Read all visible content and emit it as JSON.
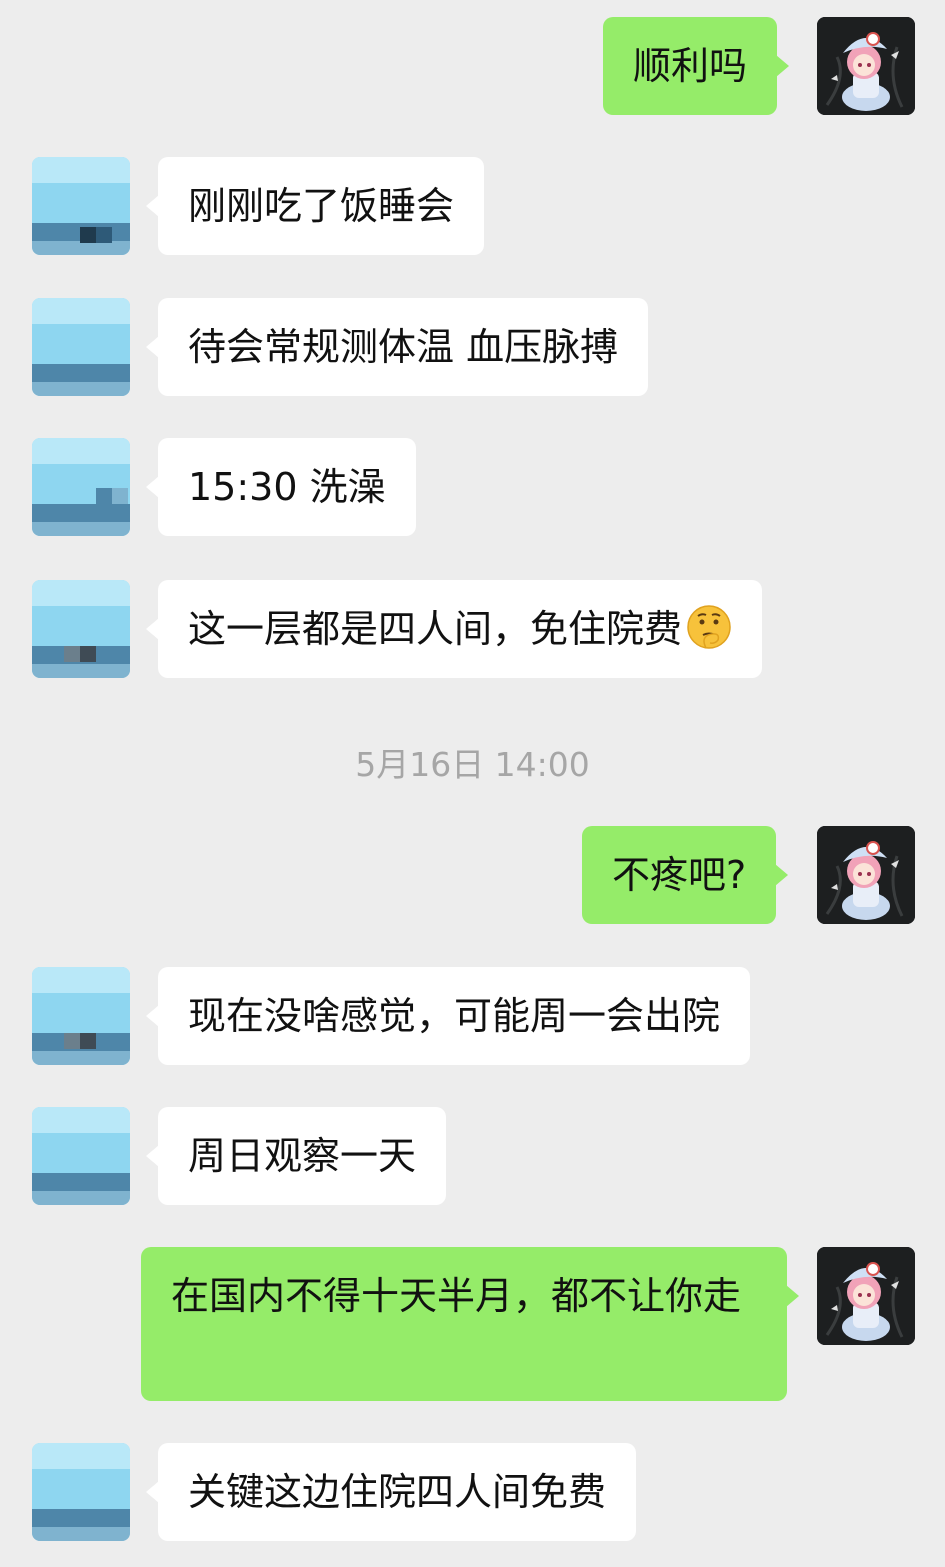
{
  "conversation": {
    "timestamp": "5月16日 14:00",
    "messages": [
      {
        "side": "right",
        "text": "顺利吗"
      },
      {
        "side": "left",
        "text": "刚刚吃了饭睡会"
      },
      {
        "side": "left",
        "text": "待会常规测体温 血压脉搏"
      },
      {
        "side": "left",
        "text": "15:30 洗澡"
      },
      {
        "side": "left",
        "text": "这一层都是四人间，免住院费",
        "emoji": "thinking-face-icon"
      },
      {
        "side": "right",
        "text": "不疼吧?"
      },
      {
        "side": "left",
        "text": "现在没啥感觉，可能周一会出院"
      },
      {
        "side": "left",
        "text": "周日观察一天"
      },
      {
        "side": "right",
        "text": "在国内不得十天半月，都不让你走"
      },
      {
        "side": "left",
        "text": "关键这边住院四人间免费"
      }
    ]
  },
  "colors": {
    "background": "#ededed",
    "incoming_bubble": "#ffffff",
    "outgoing_bubble": "#95ec69",
    "timestamp_text": "#a6a6a6"
  }
}
